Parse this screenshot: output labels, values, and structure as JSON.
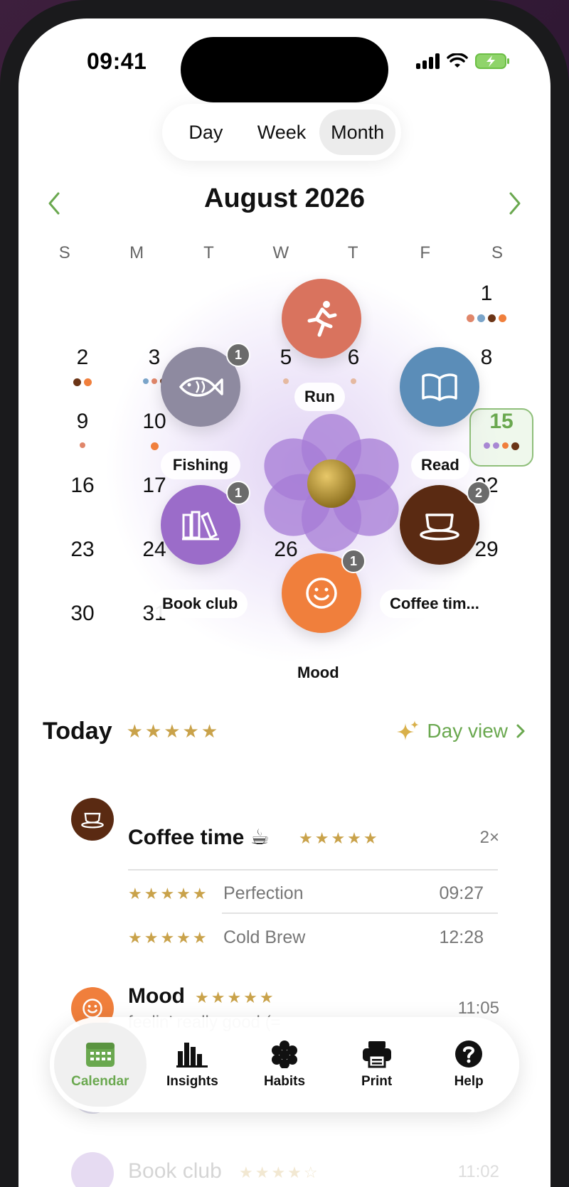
{
  "status": {
    "time": "09:41"
  },
  "segmented": {
    "day": "Day",
    "week": "Week",
    "month": "Month",
    "active": "Month"
  },
  "calendar": {
    "title": "August 2026",
    "weekdays": [
      "S",
      "M",
      "T",
      "W",
      "T",
      "F",
      "S"
    ],
    "today": "15"
  },
  "habits": {
    "run": {
      "label": "Run"
    },
    "fishing": {
      "label": "Fishing",
      "badge": "1"
    },
    "read": {
      "label": "Read"
    },
    "book_club": {
      "label": "Book club",
      "badge": "1"
    },
    "coffee": {
      "label": "Coffee tim...",
      "badge": "2"
    },
    "mood": {
      "label": "Mood",
      "badge": "1"
    }
  },
  "today": {
    "title": "Today",
    "stars": "★★★★★",
    "day_view": "Day view"
  },
  "entries": {
    "coffee": {
      "title": "Coffee time ☕",
      "stars": "★★★★★",
      "count": "2×",
      "items": [
        {
          "stars": "★★★★★",
          "text": "Perfection",
          "time": "09:27"
        },
        {
          "stars": "★★★★★",
          "text": "Cold Brew",
          "time": "12:28"
        }
      ]
    },
    "mood": {
      "title": "Mood",
      "stars": "★★★★★",
      "note": "feelin’ really good (=",
      "time": "11:05"
    },
    "book_club": {
      "title": "Book club",
      "stars": "★★★★☆",
      "time": "11:02"
    }
  },
  "tabbar": {
    "calendar": "Calendar",
    "insights": "Insights",
    "habits": "Habits",
    "print": "Print",
    "help": "Help"
  },
  "colors": {
    "accent_green": "#6aa84f",
    "star_gold": "#c9a24a",
    "run": "#d9735e",
    "fishing": "#8e8aa0",
    "read": "#5b8db8",
    "book_club": "#9b6cc9",
    "coffee": "#5a2a12",
    "mood": "#f07f3c"
  }
}
